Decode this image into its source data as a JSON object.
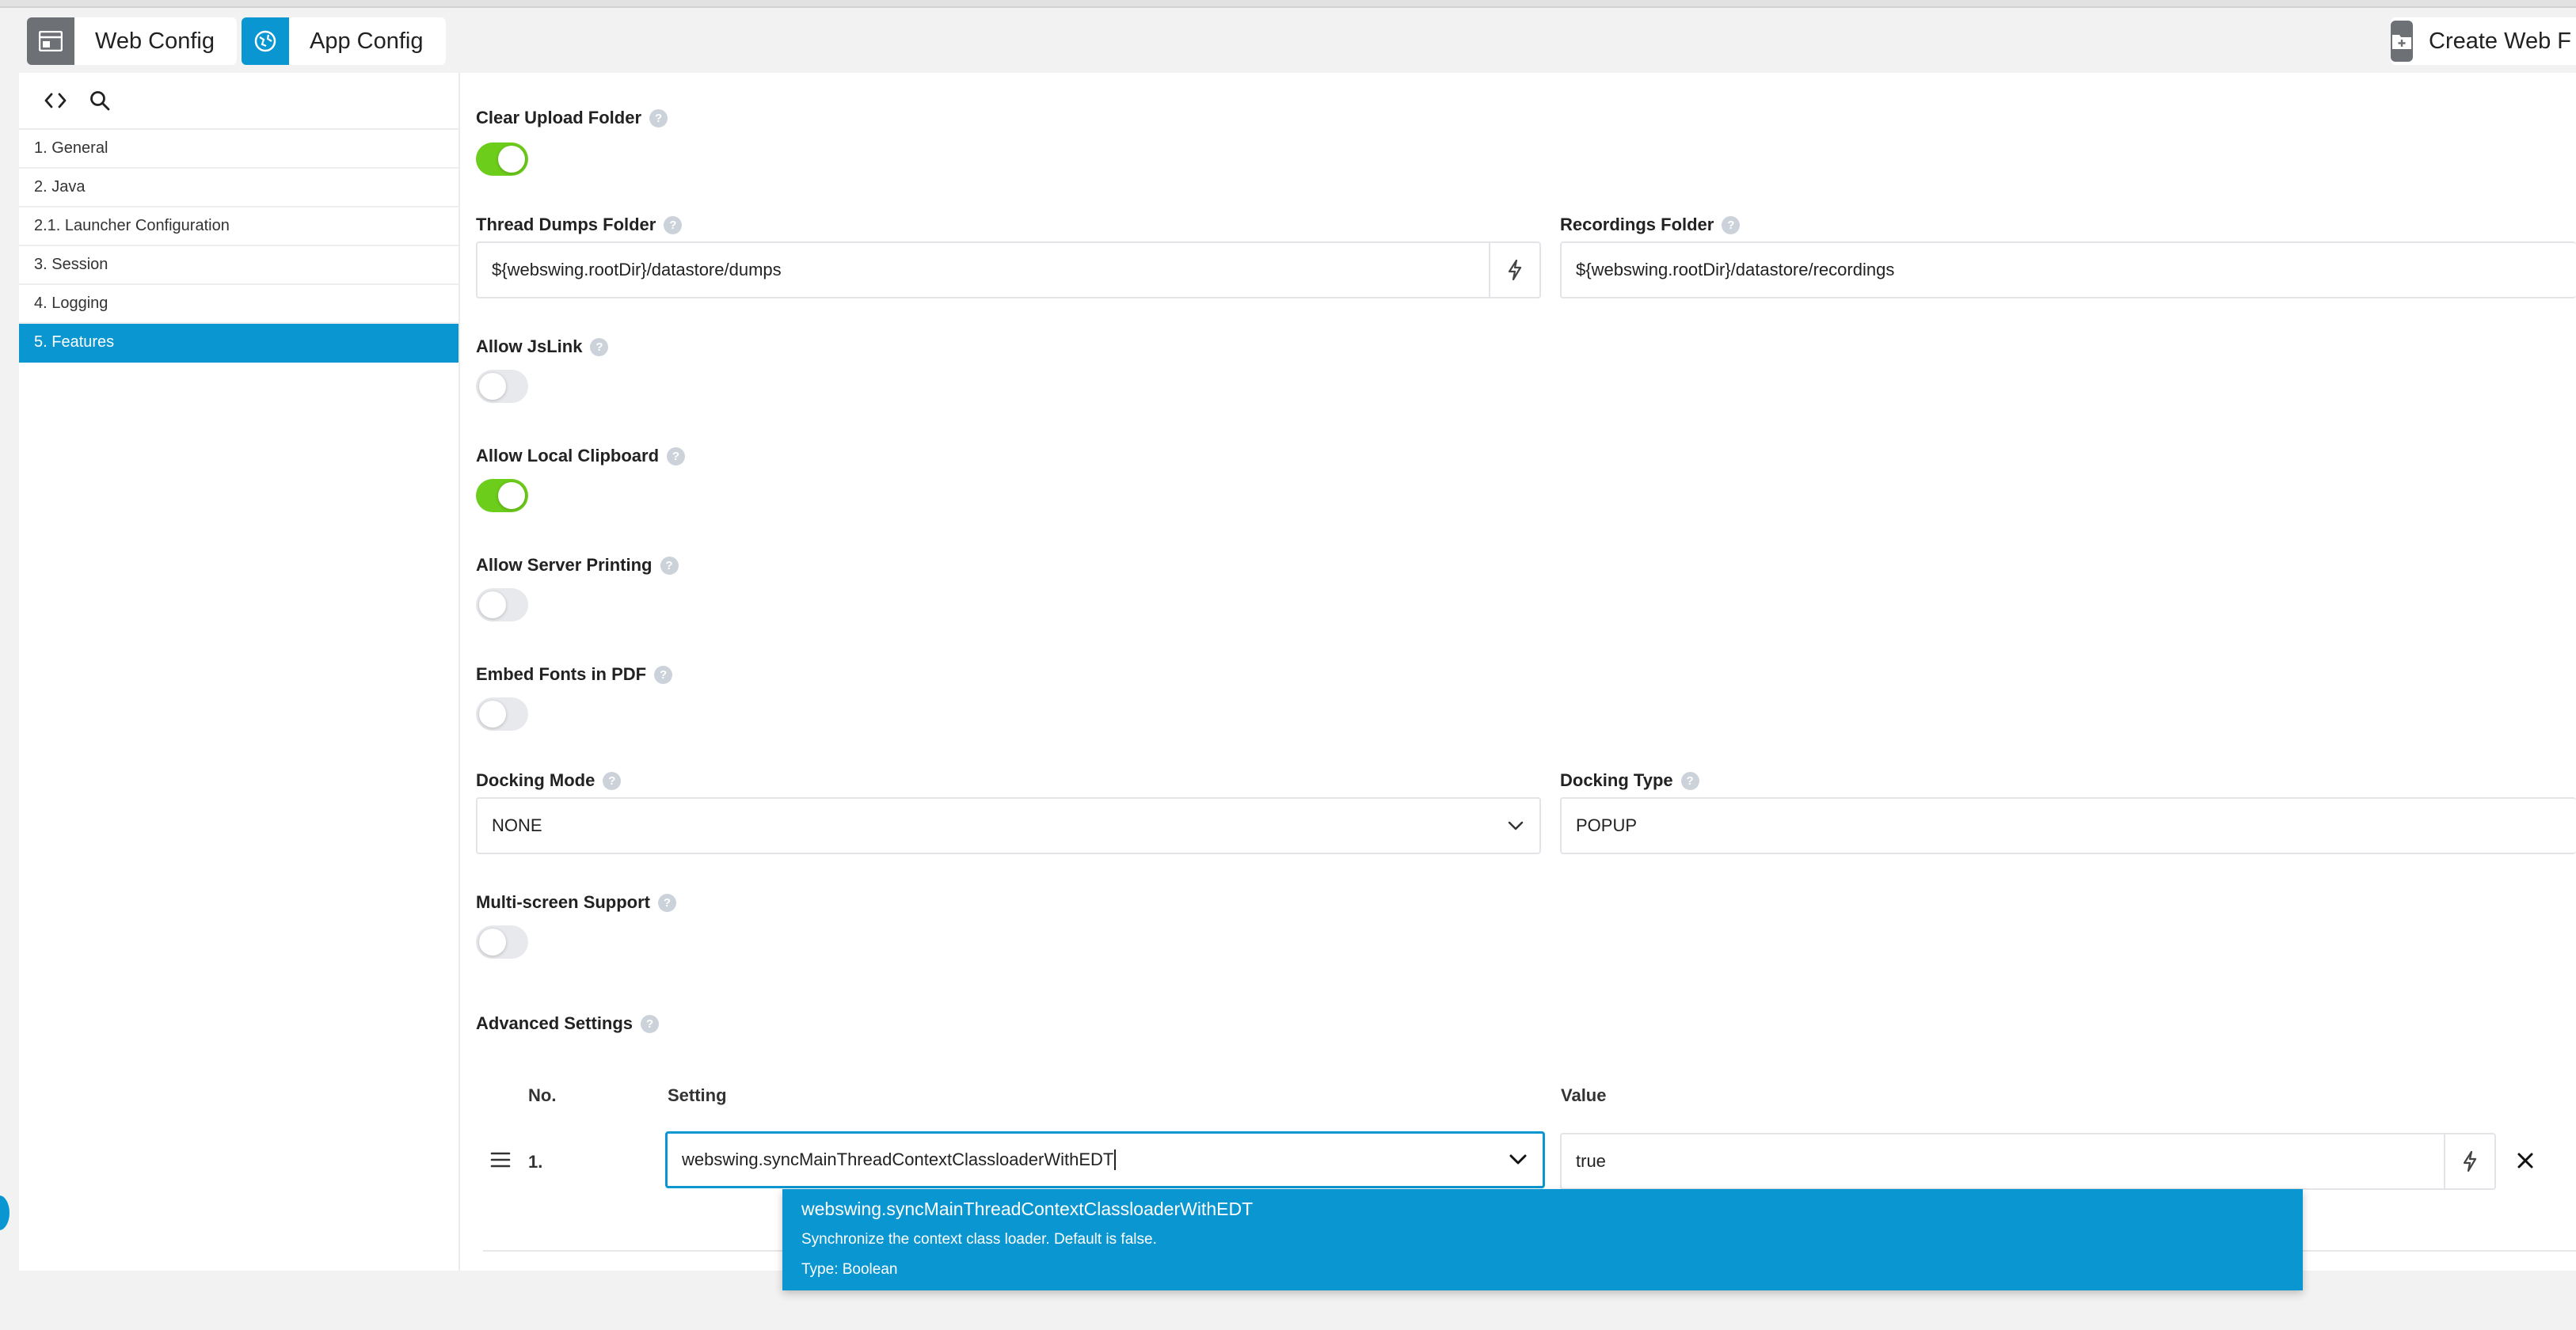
{
  "header": {
    "web_config": "Web Config",
    "app_config": "App Config",
    "create_web": "Create Web F"
  },
  "sidebar": {
    "items": [
      "1. General",
      "2. Java",
      "2.1. Launcher Configuration",
      "3. Session",
      "4. Logging",
      "5. Features"
    ],
    "active": "5. Features"
  },
  "features": {
    "clear_upload_folder": {
      "label": "Clear Upload Folder",
      "on": true
    },
    "thread_dumps_folder": {
      "label": "Thread Dumps Folder",
      "value": "${webswing.rootDir}/datastore/dumps"
    },
    "recordings_folder": {
      "label": "Recordings Folder",
      "value": "${webswing.rootDir}/datastore/recordings"
    },
    "allow_jslink": {
      "label": "Allow JsLink",
      "on": false
    },
    "allow_local_clipboard": {
      "label": "Allow Local Clipboard",
      "on": true
    },
    "allow_server_printing": {
      "label": "Allow Server Printing",
      "on": false
    },
    "embed_fonts_in_pdf": {
      "label": "Embed Fonts in PDF",
      "on": false
    },
    "docking_mode": {
      "label": "Docking Mode",
      "value": "NONE"
    },
    "docking_type": {
      "label": "Docking Type",
      "value": "POPUP"
    },
    "multi_screen_support": {
      "label": "Multi-screen Support",
      "on": false
    }
  },
  "advanced": {
    "label": "Advanced Settings",
    "columns": {
      "no": "No.",
      "setting": "Setting",
      "value": "Value"
    },
    "rows": [
      {
        "no": "1.",
        "setting": "webswing.syncMainThreadContextClassloaderWithEDT",
        "value": "true"
      }
    ],
    "suggestion": {
      "name": "webswing.syncMainThreadContextClassloaderWithEDT",
      "description": "Synchronize the context class loader. Default is false.",
      "type": "Type: Boolean"
    }
  },
  "help_glyph": "?",
  "colors": {
    "accent": "#0a96d1",
    "toggle_on": "#6ccd1a",
    "toggle_off": "#e7e9ec"
  }
}
